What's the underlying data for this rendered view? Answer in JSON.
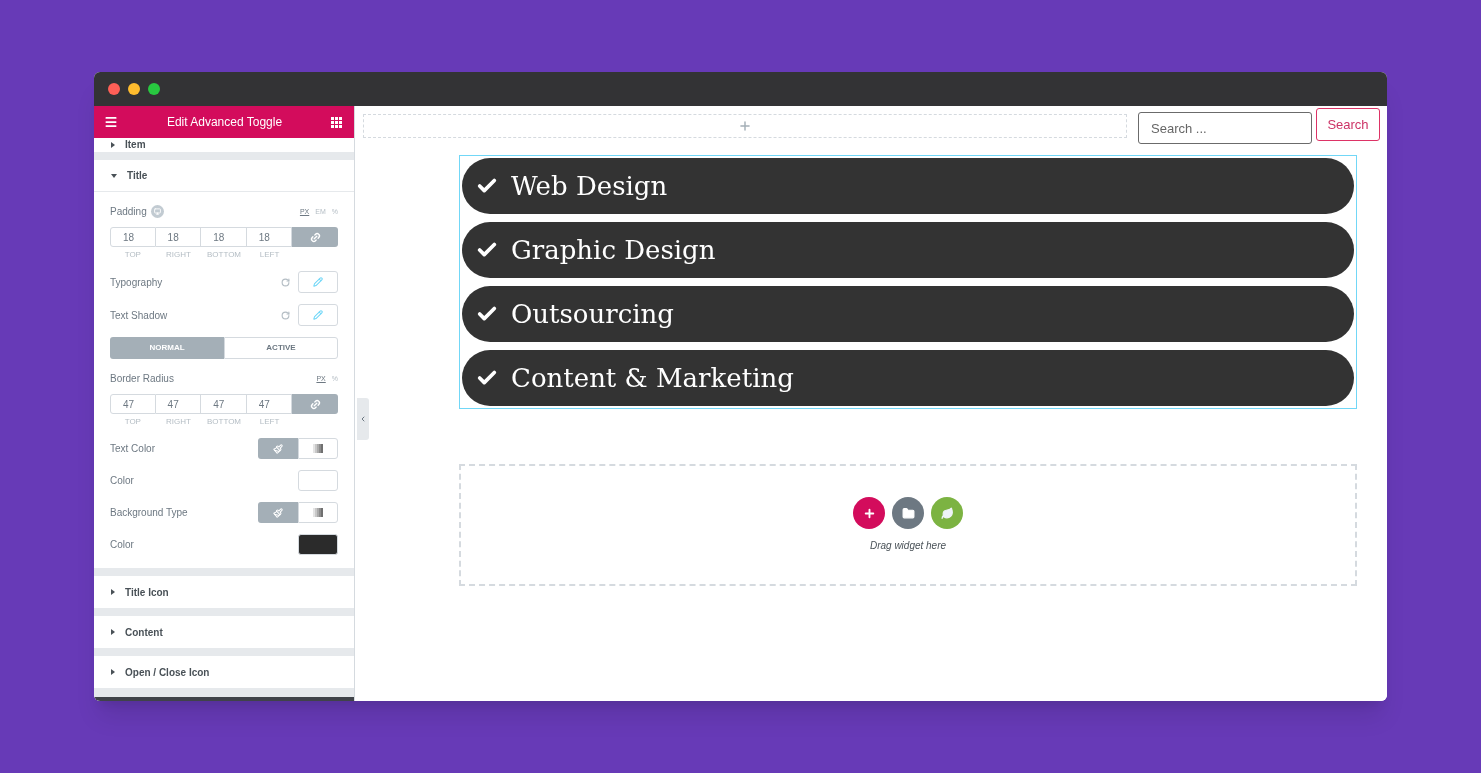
{
  "panel": {
    "title": "Edit Advanced Toggle",
    "sections": [
      {
        "label": "Item",
        "expanded": false
      },
      {
        "label": "Title",
        "expanded": true,
        "controls": [
          {
            "kind": "dimensions",
            "label": "Padding",
            "responsive": true,
            "units": [
              {
                "label": "PX",
                "selected": true
              },
              {
                "label": "EM",
                "selected": false
              },
              {
                "label": "%",
                "selected": false
              }
            ],
            "fields": [
              {
                "value": "18",
                "caption": "TOP"
              },
              {
                "value": "18",
                "caption": "RIGHT"
              },
              {
                "value": "18",
                "caption": "BOTTOM"
              },
              {
                "value": "18",
                "caption": "LEFT"
              }
            ],
            "linked": true
          },
          {
            "kind": "popover",
            "label": "Typography"
          },
          {
            "kind": "popover",
            "label": "Text Shadow"
          },
          {
            "kind": "tabs",
            "tabs": [
              {
                "label": "NORMAL",
                "selected": true
              },
              {
                "label": "ACTIVE",
                "selected": false
              }
            ]
          },
          {
            "kind": "dimensions",
            "label": "Border Radius",
            "responsive": false,
            "units": [
              {
                "label": "PX",
                "selected": true
              },
              {
                "label": "%",
                "selected": false
              }
            ],
            "fields": [
              {
                "value": "47",
                "caption": "TOP"
              },
              {
                "value": "47",
                "caption": "RIGHT"
              },
              {
                "value": "47",
                "caption": "BOTTOM"
              },
              {
                "value": "47",
                "caption": "LEFT"
              }
            ],
            "linked": true
          },
          {
            "kind": "choose",
            "label": "Text Color",
            "options": [
              {
                "selected": true
              },
              {
                "selected": false
              }
            ]
          },
          {
            "kind": "color",
            "label": "Color",
            "color": "#ffffff"
          },
          {
            "kind": "choose",
            "label": "Background Type",
            "options": [
              {
                "selected": true
              },
              {
                "selected": false
              }
            ]
          },
          {
            "kind": "color",
            "label": "Color",
            "color": "#2b2b2b"
          }
        ]
      },
      {
        "label": "Title Icon",
        "expanded": false
      },
      {
        "label": "Content",
        "expanded": false
      },
      {
        "label": "Open / Close Icon",
        "expanded": false
      }
    ]
  },
  "search": {
    "placeholder": "Search ...",
    "button": "Search"
  },
  "toggles": [
    {
      "title": "Web Design"
    },
    {
      "title": "Graphic Design"
    },
    {
      "title": "Outsourcing"
    },
    {
      "title": "Content & Marketing"
    }
  ],
  "drop_zone": {
    "hint": "Drag widget here"
  }
}
